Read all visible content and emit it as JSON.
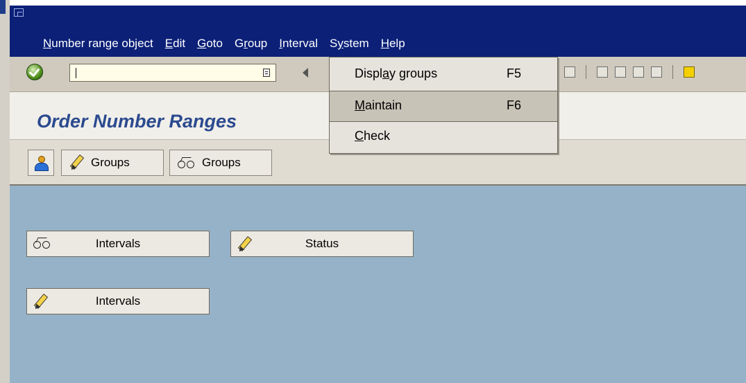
{
  "menubar": {
    "items": [
      {
        "pre": "",
        "u": "N",
        "post": "umber range object"
      },
      {
        "pre": "",
        "u": "E",
        "post": "dit"
      },
      {
        "pre": "",
        "u": "G",
        "post": "oto"
      },
      {
        "pre": "G",
        "u": "r",
        "post": "oup"
      },
      {
        "pre": "",
        "u": "I",
        "post": "nterval"
      },
      {
        "pre": "S",
        "u": "y",
        "post": "stem"
      },
      {
        "pre": "",
        "u": "H",
        "post": "elp"
      }
    ]
  },
  "toolbar": {
    "command_field_value": "",
    "icons": [
      "enter-icon",
      "command-dropdown-icon",
      "back-icon",
      "print-icon",
      "find-icon",
      "find-next-icon",
      "first-page-icon",
      "previous-page-icon",
      "create-session-icon"
    ]
  },
  "title": {
    "text": "Order Number Ranges"
  },
  "app_toolbar": {
    "change_groups": "Groups",
    "display_groups": "Groups"
  },
  "content": {
    "display_intervals": "Intervals",
    "status": "Status",
    "change_intervals": "Intervals"
  },
  "dropdown": {
    "open_menu": "Group",
    "items": [
      {
        "pre": "Displ",
        "u": "a",
        "post": "y groups",
        "shortcut": "F5"
      },
      {
        "pre": "",
        "u": "M",
        "post": "aintain",
        "shortcut": "F6",
        "highlighted": true
      },
      {
        "pre": "",
        "u": "C",
        "post": "heck",
        "shortcut": ""
      }
    ]
  },
  "colors": {
    "menubar_bg": "#0c2078",
    "content_bg": "#96b2c9",
    "title_text": "#2b4a8f",
    "dropdown_bg": "#e6e3dc",
    "dropdown_highlight": "#c8c3b7"
  }
}
